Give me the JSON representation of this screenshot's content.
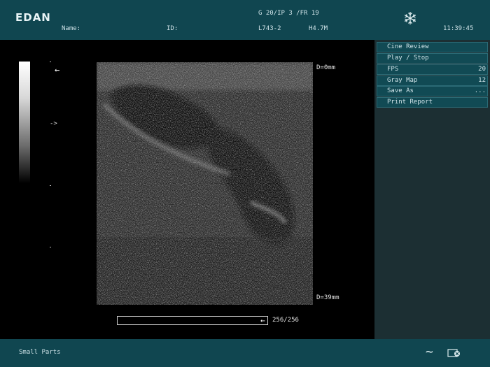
{
  "header": {
    "logo": "EDAN",
    "name_label": "Name:",
    "id_label": "ID:",
    "gain_line": "G 20/IP 3 /FR 19",
    "probe": "L743-2",
    "frequency": "H4.7M",
    "time": "11:39:45",
    "freeze_icon": "snowflake-icon"
  },
  "menu": {
    "items": [
      {
        "label": "Cine Review",
        "value": ""
      },
      {
        "label": "Play / Stop",
        "value": ""
      },
      {
        "label": "FPS",
        "value": "20"
      },
      {
        "label": "Gray Map",
        "value": "12"
      },
      {
        "label": "Save As",
        "value": "..."
      },
      {
        "label": "Print Report",
        "value": ""
      }
    ]
  },
  "image": {
    "depth_top": "D=0mm",
    "depth_bottom": "D=39mm",
    "focus_marker": ">",
    "left_arrow": "←"
  },
  "cine": {
    "counter": "256/256",
    "arrow": "←",
    "position": 1.0
  },
  "footer": {
    "preset": "Small Parts",
    "wave_icon": "wave-icon",
    "probe_icon": "probe-icon"
  },
  "colors": {
    "bar_bg": "#104650",
    "panel_bg": "#1c2f33",
    "menu_bg": "#114a54"
  }
}
